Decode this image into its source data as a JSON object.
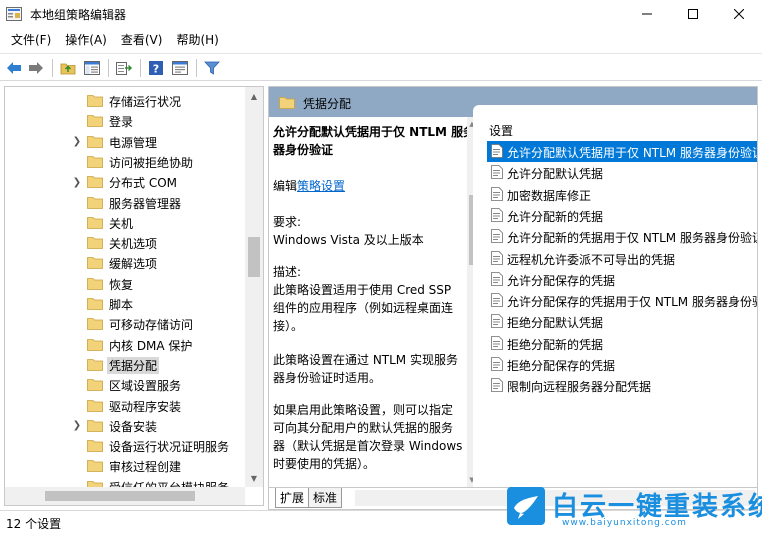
{
  "window": {
    "title": "本地组策略编辑器"
  },
  "menu": {
    "items": [
      "文件(F)",
      "操作(A)",
      "查看(V)",
      "帮助(H)"
    ]
  },
  "toolbar": {
    "icons": [
      "back-arrow-icon",
      "forward-arrow-icon",
      "up-folder-icon",
      "show-hide-tree-icon",
      "export-list-icon",
      "help-icon",
      "properties-icon",
      "filter-icon"
    ]
  },
  "tree": {
    "items": [
      {
        "label": "存储运行状况",
        "expandable": false
      },
      {
        "label": "登录",
        "expandable": false
      },
      {
        "label": "电源管理",
        "expandable": true
      },
      {
        "label": "访问被拒绝协助",
        "expandable": false
      },
      {
        "label": "分布式 COM",
        "expandable": true
      },
      {
        "label": "服务器管理器",
        "expandable": false
      },
      {
        "label": "关机",
        "expandable": false
      },
      {
        "label": "关机选项",
        "expandable": false
      },
      {
        "label": "缓解选项",
        "expandable": false
      },
      {
        "label": "恢复",
        "expandable": false
      },
      {
        "label": "脚本",
        "expandable": false
      },
      {
        "label": "可移动存储访问",
        "expandable": false
      },
      {
        "label": "内核 DMA 保护",
        "expandable": false
      },
      {
        "label": "凭据分配",
        "expandable": false,
        "selected": true
      },
      {
        "label": "区域设置服务",
        "expandable": false
      },
      {
        "label": "驱动程序安装",
        "expandable": false
      },
      {
        "label": "设备安装",
        "expandable": true
      },
      {
        "label": "设备运行状况证明服务",
        "expandable": false
      },
      {
        "label": "审核过程创建",
        "expandable": false
      },
      {
        "label": "受信任的平台模块服务",
        "expandable": false
      }
    ]
  },
  "right_pane": {
    "header": "凭据分配",
    "description": {
      "title": "允许分配默认凭据用于仅 NTLM 服务器身份验证",
      "edit_prefix": "编辑",
      "edit_link": "策略设置",
      "requirement_label": "要求:",
      "requirement_value": "Windows Vista 及以上版本",
      "desc_label": "描述:",
      "desc_para1": "此策略设置适用于使用 Cred SSP 组件的应用程序（例如远程桌面连接）。",
      "desc_para2": "此策略设置在通过 NTLM 实现服务器身份验证时适用。",
      "desc_para3": "如果启用此策略设置，则可以指定可向其分配用户的默认凭据的服务器（默认凭据是首次登录 Windows 时要使用的凭据）。"
    },
    "list_header": "设置",
    "settings": [
      {
        "label": "允许分配默认凭据用于仅 NTLM 服务器身份验证",
        "selected": true
      },
      {
        "label": "允许分配默认凭据"
      },
      {
        "label": "加密数据库修正"
      },
      {
        "label": "允许分配新的凭据"
      },
      {
        "label": "允许分配新的凭据用于仅 NTLM 服务器身份验证"
      },
      {
        "label": "远程机允许委派不可导出的凭据"
      },
      {
        "label": "允许分配保存的凭据"
      },
      {
        "label": "允许分配保存的凭据用于仅 NTLM 服务器身份验证"
      },
      {
        "label": "拒绝分配默认凭据"
      },
      {
        "label": "拒绝分配新的凭据"
      },
      {
        "label": "拒绝分配保存的凭据"
      },
      {
        "label": "限制向远程服务器分配凭据"
      }
    ],
    "tabs": [
      "扩展",
      "标准"
    ]
  },
  "statusbar": {
    "text": "12 个设置"
  },
  "watermark": {
    "title": "白云一键重装系统",
    "url": "www.baiyunxitong.com"
  },
  "colors": {
    "header_bg": "#8fa9c4",
    "selected_bg": "#0078d7",
    "link": "#0066cc",
    "watermark": "#1a8fe0"
  }
}
